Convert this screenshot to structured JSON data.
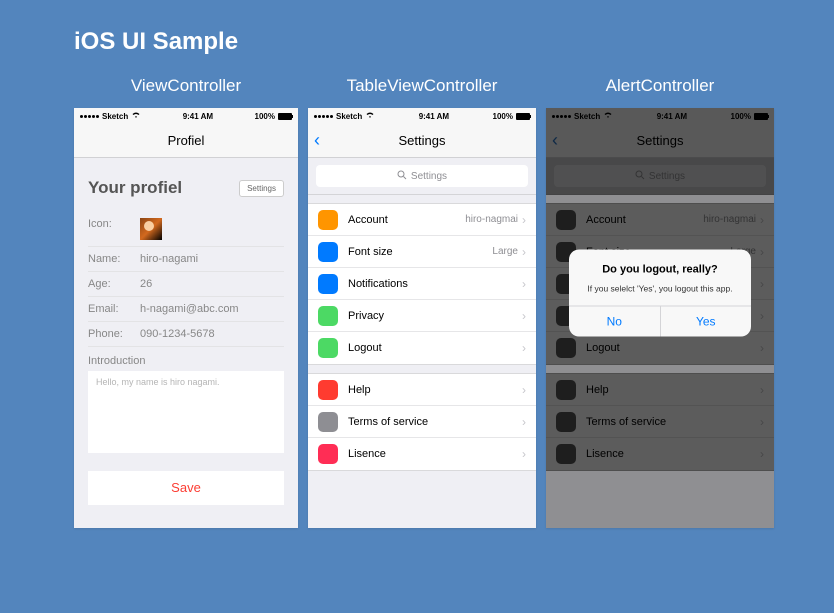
{
  "page": {
    "title": "iOS UI Sample"
  },
  "columns": {
    "vc": "ViewController",
    "tvc": "TableViewController",
    "ac": "AlertController"
  },
  "status": {
    "carrier": "Sketch",
    "time": "9:41 AM",
    "battery": "100%"
  },
  "profile": {
    "navTitle": "Profiel",
    "heading": "Your profiel",
    "settingsBtn": "Settings",
    "iconLabel": "Icon:",
    "nameLabel": "Name:",
    "name": "hiro-nagami",
    "ageLabel": "Age:",
    "age": "26",
    "emailLabel": "Email:",
    "email": "h-nagami@abc.com",
    "phoneLabel": "Phone:",
    "phone": "090-1234-5678",
    "introLabel": "Introduction",
    "introText": "Hello, my name is hiro nagami.",
    "saveBtn": "Save"
  },
  "settings": {
    "navTitle": "Settings",
    "searchPlaceholder": "Settings",
    "section1": [
      {
        "icon": "#ff9500",
        "label": "Account",
        "detail": "hiro-nagmai"
      },
      {
        "icon": "#007aff",
        "label": "Font size",
        "detail": "Large"
      },
      {
        "icon": "#007aff",
        "label": "Notifications",
        "detail": ""
      },
      {
        "icon": "#4cd964",
        "label": "Privacy",
        "detail": ""
      },
      {
        "icon": "#4cd964",
        "label": "Logout",
        "detail": ""
      }
    ],
    "section2": [
      {
        "icon": "#ff3b30",
        "label": "Help"
      },
      {
        "icon": "#8e8e93",
        "label": "Terms of service"
      },
      {
        "icon": "#ff2d55",
        "label": "Lisence"
      }
    ]
  },
  "alert": {
    "title": "Do you logout, really?",
    "message": "If you selelct 'Yes', you logout this app.",
    "no": "No",
    "yes": "Yes"
  }
}
